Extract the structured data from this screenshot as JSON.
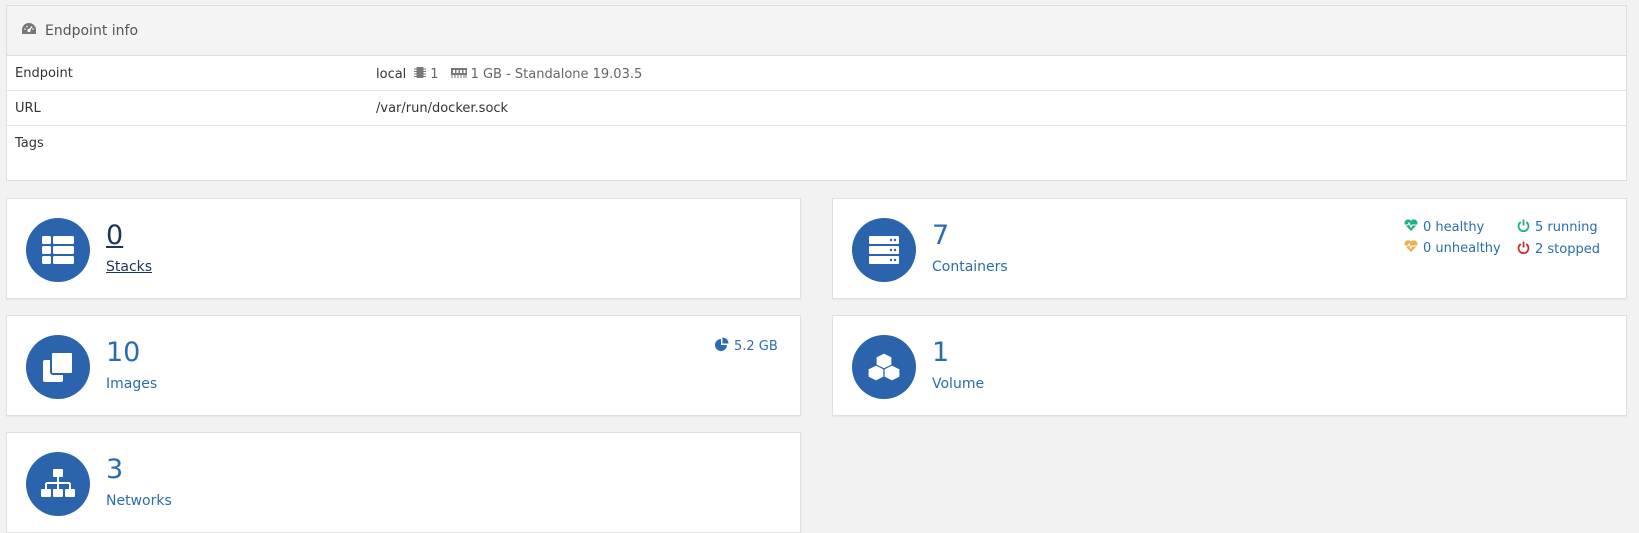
{
  "panel": {
    "title": "Endpoint info"
  },
  "rows": {
    "endpoint_label": "Endpoint",
    "endpoint_name": "local",
    "cpu_count": "1",
    "memory_info": "1 GB - Standalone 19.03.5",
    "url_label": "URL",
    "url_value": "/var/run/docker.sock",
    "tags_label": "Tags"
  },
  "cards": {
    "stacks": {
      "count": "0",
      "label": "Stacks"
    },
    "containers": {
      "count": "7",
      "label": "Containers",
      "healthy": "0 healthy",
      "unhealthy": "0 unhealthy",
      "running": "5 running",
      "stopped": "2 stopped"
    },
    "images": {
      "count": "10",
      "label": "Images",
      "size": "5.2 GB"
    },
    "volumes": {
      "count": "1",
      "label": "Volume"
    },
    "networks": {
      "count": "3",
      "label": "Networks"
    }
  },
  "colors": {
    "accent": "#2b63ac",
    "healthy": "#23ae89",
    "unhealthy": "#f0ad4e",
    "running": "#23ae89",
    "stopped": "#c9302c"
  },
  "icons": [
    "tachometer-icon",
    "microchip-icon",
    "memory-icon",
    "th-list-icon",
    "server-icon",
    "clone-icon",
    "cubes-icon",
    "sitemap-icon",
    "pie-chart-icon",
    "heartbeat-icon",
    "power-off-icon"
  ]
}
